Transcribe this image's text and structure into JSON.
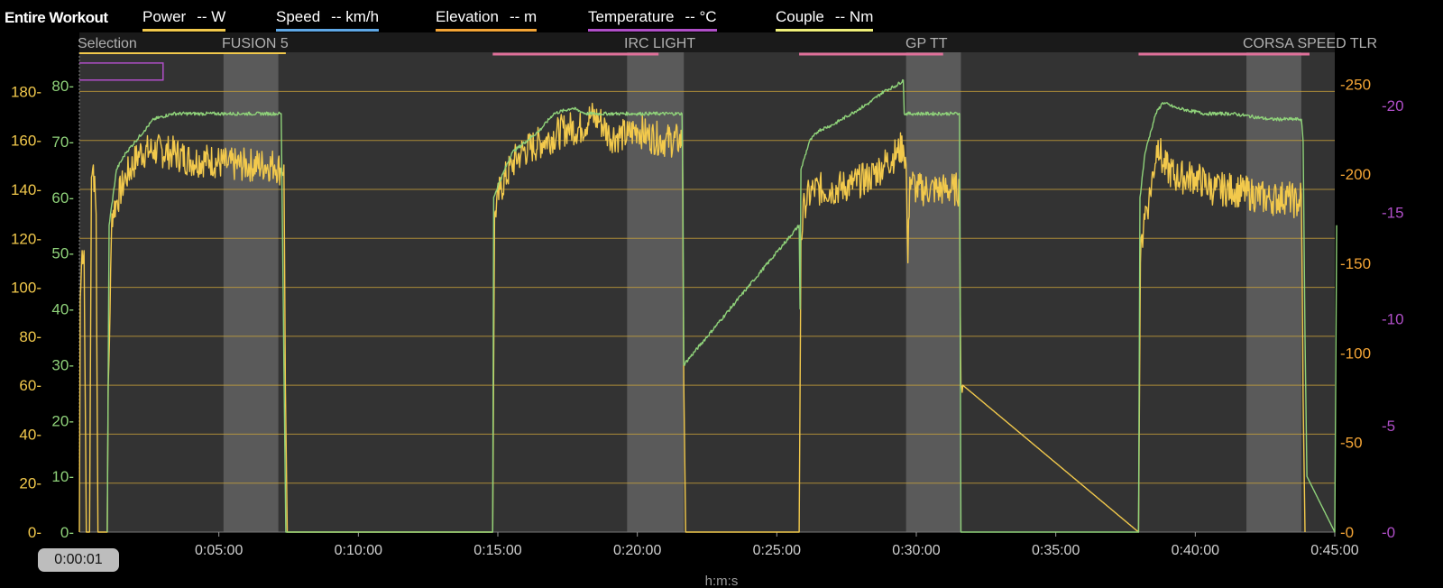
{
  "legend": {
    "title": "Entire Workout",
    "items": [
      {
        "name": "Power",
        "unit": "-- W",
        "color": "#f2c94c"
      },
      {
        "name": "Speed",
        "unit": "-- km/h",
        "color": "#5fa8e6"
      },
      {
        "name": "Elevation",
        "unit": "-- m",
        "color": "#f4a536"
      },
      {
        "name": "Temperature",
        "unit": "-- °C",
        "color": "#b04fc8"
      },
      {
        "name": "Couple",
        "unit": "-- Nm",
        "color": "#f0f07a"
      }
    ]
  },
  "time_badge": "0:00:01",
  "chart_data": {
    "type": "line",
    "xlabel": "h:m:s",
    "x_range_seconds": [
      0,
      2700
    ],
    "x_ticks": [
      "0:05:00",
      "0:10:00",
      "0:15:00",
      "0:20:00",
      "0:25:00",
      "0:30:00",
      "0:35:00",
      "0:40:00",
      "0:45:00"
    ],
    "x_tick_seconds": [
      300,
      600,
      900,
      1200,
      1500,
      1800,
      2100,
      2400,
      2700
    ],
    "segments": [
      {
        "label": "Selection",
        "start_s": 0,
        "end_s": 300
      },
      {
        "label": "FUSION 5",
        "start_s": 0,
        "end_s": 444
      },
      {
        "label": "IRC LIGHT",
        "start_s": 889,
        "end_s": 1300
      },
      {
        "label": "GP TT",
        "start_s": 1548,
        "end_s": 1912
      },
      {
        "label": "CORSA SPEED TLR",
        "start_s": 2278,
        "end_s": 2700
      }
    ],
    "highlight_ranges_s": [
      [
        310,
        428
      ],
      [
        1178,
        1300
      ],
      [
        1778,
        1896
      ],
      [
        2510,
        2628
      ]
    ],
    "axes": {
      "left_power": {
        "label_ticks": [
          0,
          20,
          40,
          60,
          80,
          100,
          120,
          140,
          160,
          180
        ],
        "range": [
          0,
          196
        ],
        "color": "#f2c94c"
      },
      "left_speed": {
        "label_ticks": [
          0,
          10,
          20,
          30,
          40,
          50,
          60,
          70,
          80
        ],
        "range": [
          0,
          86
        ],
        "color": "#8fd27a"
      },
      "right_elevation": {
        "label_ticks": [
          0,
          50,
          100,
          150,
          200,
          250
        ],
        "range": [
          0,
          268
        ],
        "color": "#f4a536"
      },
      "right_temperature": {
        "label_ticks": [
          0,
          5,
          10,
          15,
          20
        ],
        "range": [
          0,
          22.5
        ],
        "color": "#b04fc8"
      }
    },
    "gridlines_power": [
      20,
      40,
      60,
      80,
      100,
      120,
      140,
      160,
      180
    ],
    "series": [
      {
        "name": "Power",
        "color": "#f2c94c",
        "axis": "left_power",
        "points": [
          [
            0,
            0
          ],
          [
            2,
            95
          ],
          [
            6,
            115
          ],
          [
            10,
            115
          ],
          [
            15,
            0
          ],
          [
            22,
            0
          ],
          [
            26,
            145
          ],
          [
            30,
            150
          ],
          [
            36,
            130
          ],
          [
            40,
            0
          ],
          [
            60,
            0
          ],
          [
            62,
            60
          ],
          [
            66,
            90
          ],
          [
            70,
            130
          ],
          [
            80,
            135
          ],
          [
            100,
            145
          ],
          [
            130,
            155
          ],
          [
            160,
            156
          ],
          [
            200,
            155
          ],
          [
            240,
            152
          ],
          [
            280,
            152
          ],
          [
            320,
            150
          ],
          [
            360,
            150
          ],
          [
            400,
            150
          ],
          [
            420,
            150
          ],
          [
            434,
            148
          ],
          [
            440,
            150
          ],
          [
            443,
            60
          ],
          [
            447,
            0
          ],
          [
            889,
            0
          ],
          [
            893,
            130
          ],
          [
            905,
            140
          ],
          [
            930,
            150
          ],
          [
            950,
            155
          ],
          [
            1000,
            160
          ],
          [
            1050,
            165
          ],
          [
            1080,
            165
          ],
          [
            1100,
            170
          ],
          [
            1120,
            168
          ],
          [
            1140,
            162
          ],
          [
            1160,
            162
          ],
          [
            1180,
            162
          ],
          [
            1200,
            165
          ],
          [
            1220,
            162
          ],
          [
            1260,
            160
          ],
          [
            1290,
            160
          ],
          [
            1297,
            160
          ],
          [
            1300,
            60
          ],
          [
            1304,
            0
          ],
          [
            1548,
            0
          ],
          [
            1552,
            120
          ],
          [
            1560,
            135
          ],
          [
            1580,
            140
          ],
          [
            1620,
            140
          ],
          [
            1660,
            142
          ],
          [
            1700,
            145
          ],
          [
            1730,
            150
          ],
          [
            1760,
            155
          ],
          [
            1772,
            158
          ],
          [
            1778,
            150
          ],
          [
            1782,
            110
          ],
          [
            1786,
            145
          ],
          [
            1800,
            140
          ],
          [
            1830,
            140
          ],
          [
            1860,
            140
          ],
          [
            1880,
            140
          ],
          [
            1893,
            140
          ],
          [
            1896,
            60
          ],
          [
            1900,
            60
          ],
          [
            2278,
            0
          ],
          [
            2282,
            110
          ],
          [
            2290,
            130
          ],
          [
            2300,
            135
          ],
          [
            2320,
            160
          ],
          [
            2330,
            150
          ],
          [
            2360,
            145
          ],
          [
            2400,
            145
          ],
          [
            2440,
            140
          ],
          [
            2480,
            140
          ],
          [
            2520,
            138
          ],
          [
            2560,
            136
          ],
          [
            2600,
            137
          ],
          [
            2620,
            134
          ],
          [
            2628,
            138
          ],
          [
            2632,
            55
          ],
          [
            2636,
            0
          ]
        ]
      },
      {
        "name": "Speed",
        "color": "#8fd27a",
        "axis": "left_speed",
        "points": [
          [
            60,
            0
          ],
          [
            64,
            55
          ],
          [
            80,
            65
          ],
          [
            100,
            68
          ],
          [
            120,
            70
          ],
          [
            140,
            72
          ],
          [
            160,
            74
          ],
          [
            200,
            75
          ],
          [
            260,
            75
          ],
          [
            320,
            75
          ],
          [
            380,
            75
          ],
          [
            428,
            75
          ],
          [
            434,
            75
          ],
          [
            436,
            60
          ],
          [
            440,
            30
          ],
          [
            444,
            0
          ],
          [
            889,
            0
          ],
          [
            891,
            60
          ],
          [
            900,
            62
          ],
          [
            930,
            68
          ],
          [
            960,
            70
          ],
          [
            990,
            72
          ],
          [
            1020,
            75
          ],
          [
            1060,
            76
          ],
          [
            1090,
            75
          ],
          [
            1150,
            75
          ],
          [
            1220,
            75
          ],
          [
            1290,
            75
          ],
          [
            1296,
            75
          ],
          [
            1298,
            60
          ],
          [
            1300,
            30
          ],
          [
            1548,
            55
          ],
          [
            1550,
            40
          ],
          [
            1552,
            65
          ],
          [
            1570,
            70
          ],
          [
            1590,
            72
          ],
          [
            1620,
            73
          ],
          [
            1660,
            75
          ],
          [
            1700,
            77
          ],
          [
            1730,
            79
          ],
          [
            1756,
            80
          ],
          [
            1772,
            81
          ],
          [
            1774,
            75
          ],
          [
            1800,
            75
          ],
          [
            1860,
            75
          ],
          [
            1893,
            75
          ],
          [
            1896,
            0
          ],
          [
            2278,
            0
          ],
          [
            2281,
            60
          ],
          [
            2292,
            68
          ],
          [
            2305,
            72
          ],
          [
            2315,
            75
          ],
          [
            2330,
            77
          ],
          [
            2360,
            76
          ],
          [
            2420,
            75
          ],
          [
            2480,
            75
          ],
          [
            2560,
            74
          ],
          [
            2628,
            74
          ],
          [
            2632,
            70
          ],
          [
            2636,
            35
          ],
          [
            2640,
            10
          ],
          [
            2700,
            0
          ],
          [
            2704,
            55
          ]
        ]
      },
      {
        "name": "Temperature",
        "color": "#b04fc8",
        "axis": "right_temperature",
        "points": [
          [
            0,
            22
          ],
          [
            180,
            22
          ],
          [
            180,
            21.2
          ],
          [
            0,
            21.2
          ]
        ]
      }
    ]
  }
}
